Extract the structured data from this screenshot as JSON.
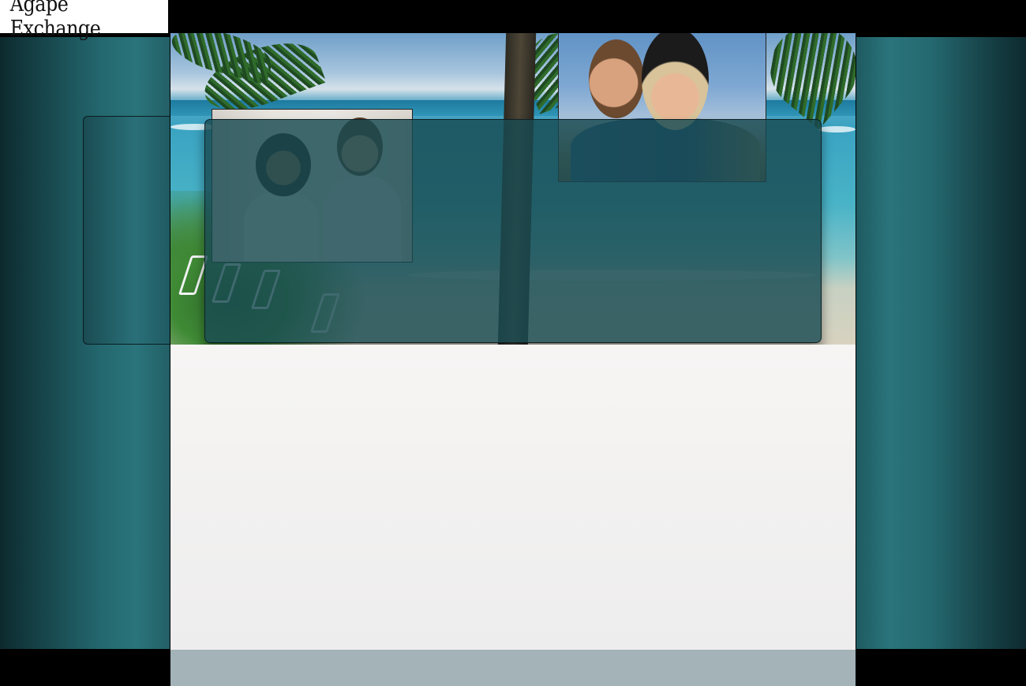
{
  "site": {
    "logo_text": "Agape Exchange"
  },
  "hero": {
    "scene": "tropical-beach-icon",
    "photos": [
      {
        "name": "couple-photo-1"
      },
      {
        "name": "couple-photo-2"
      }
    ]
  },
  "colors": {
    "teal_dark": "#0d2a2e",
    "teal_light": "#2a747b",
    "overlay": "#184a52",
    "content_bg": "#f3f2f1",
    "footer_bar": "#a3b3b8"
  }
}
